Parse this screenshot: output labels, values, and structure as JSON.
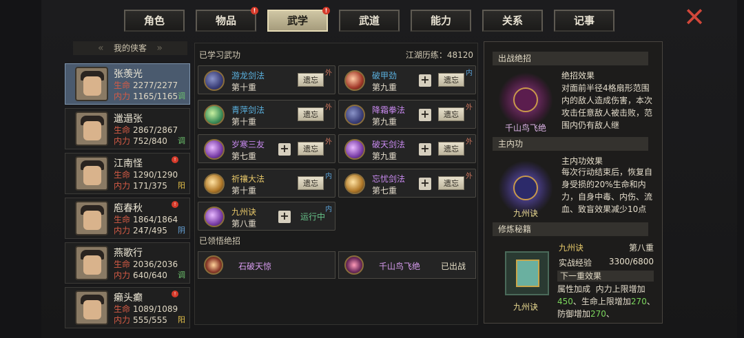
{
  "tabs": [
    {
      "label": "角色",
      "badge": ""
    },
    {
      "label": "物品",
      "badge": "!"
    },
    {
      "label": "武学",
      "badge": "!",
      "active": true
    },
    {
      "label": "武道",
      "badge": ""
    },
    {
      "label": "能力",
      "badge": ""
    },
    {
      "label": "关系",
      "badge": ""
    },
    {
      "label": "记事",
      "badge": ""
    }
  ],
  "left": {
    "title": "我的侠客",
    "heroes": [
      {
        "name": "张羡光",
        "hp_label": "生命",
        "hp": "2277/2277",
        "mp_label": "内力",
        "mp": "1165/1165",
        "tag": "调",
        "tag_color": "#6ec36e",
        "alert": ""
      },
      {
        "name": "邋遢张",
        "hp_label": "生命",
        "hp": "2867/2867",
        "mp_label": "内力",
        "mp": "752/840",
        "tag": "调",
        "tag_color": "#6ec36e",
        "alert": ""
      },
      {
        "name": "江南怪",
        "hp_label": "生命",
        "hp": "1290/1290",
        "mp_label": "内力",
        "mp": "171/375",
        "tag": "阳",
        "tag_color": "#e6c24a",
        "alert": "!"
      },
      {
        "name": "庖春秋",
        "hp_label": "生命",
        "hp": "1864/1864",
        "mp_label": "内力",
        "mp": "247/495",
        "tag": "阴",
        "tag_color": "#6aa8e0",
        "alert": "!"
      },
      {
        "name": "燕歌行",
        "hp_label": "生命",
        "hp": "2036/2036",
        "mp_label": "内力",
        "mp": "640/640",
        "tag": "调",
        "tag_color": "#6ec36e",
        "alert": ""
      },
      {
        "name": "癞头癫",
        "hp_label": "生命",
        "hp": "1089/1089",
        "mp_label": "内力",
        "mp": "555/555",
        "tag": "阳",
        "tag_color": "#e6c24a",
        "alert": "!"
      }
    ]
  },
  "middle": {
    "learned_title": "已学习武功",
    "experience": "江湖历练：48120",
    "skills": [
      {
        "name": "游龙剑法",
        "level": "第十重",
        "type": "外",
        "btn": "遗忘",
        "plus": false,
        "color": "#5bb2e0",
        "icon": "blue"
      },
      {
        "name": "破甲劲",
        "level": "第九重",
        "type": "内",
        "btn": "遗忘",
        "plus": true,
        "color": "#5bb2e0",
        "icon": "red"
      },
      {
        "name": "青萍剑法",
        "level": "第十重",
        "type": "外",
        "btn": "遗忘",
        "plus": false,
        "color": "#5bb2e0",
        "icon": "green"
      },
      {
        "name": "降霜拳法",
        "level": "第九重",
        "type": "外",
        "btn": "遗忘",
        "plus": true,
        "color": "#c98af0",
        "icon": "blue"
      },
      {
        "name": "岁寒三友",
        "level": "第七重",
        "type": "外",
        "btn": "遗忘",
        "plus": true,
        "color": "#c98af0",
        "icon": "purple"
      },
      {
        "name": "破天剑法",
        "level": "第九重",
        "type": "外",
        "btn": "遗忘",
        "plus": true,
        "color": "#c98af0",
        "icon": "purple"
      },
      {
        "name": "祈禳大法",
        "level": "第十重",
        "type": "内",
        "btn": "遗忘",
        "plus": false,
        "color": "#e8c86a",
        "icon": "gold"
      },
      {
        "name": "忘忧剑法",
        "level": "第七重",
        "type": "外",
        "btn": "遗忘",
        "plus": true,
        "color": "#c98af0",
        "icon": "gold"
      },
      {
        "name": "九州诀",
        "level": "第八重",
        "type": "内",
        "btn": "",
        "plus": true,
        "running": "运行中",
        "color": "#e8c86a",
        "icon": "purple"
      }
    ],
    "ult_title": "已领悟绝招",
    "ults": [
      {
        "name": "石破天惊",
        "status": ""
      },
      {
        "name": "千山鸟飞绝",
        "status": "已出战"
      }
    ]
  },
  "right": {
    "battle_head": "出战绝招",
    "battle_name": "千山鸟飞绝",
    "battle_effect_title": "绝招效果",
    "battle_effect": "对面前半径4格扇形范围内的敌人造成伤害，本次攻击任意敌人被击败，范围内仍有敌人继",
    "inner_head": "主内功",
    "inner_name": "九州诀",
    "inner_effect_title": "主内功效果",
    "inner_effect": "每次行动结束后，恢复自身受损的20%生命和内力，自身中毒、内伤、流血、致盲效果减少10点",
    "manual_head": "修炼秘籍",
    "manual_name": "九州诀",
    "manual_level": "第八重",
    "manual_book": "九州诀",
    "exp_label": "实战经验",
    "exp_value": "3300/6800",
    "next_head": "下一重效果",
    "bonus_label": "属性加成",
    "bonus_a": "内力上限增加",
    "bonus_a_val": "450",
    "bonus_b": "、生命上限增加",
    "bonus_b_val": "270",
    "bonus_c": "、防御增加",
    "bonus_c_val": "270",
    "bonus_d": "、"
  }
}
